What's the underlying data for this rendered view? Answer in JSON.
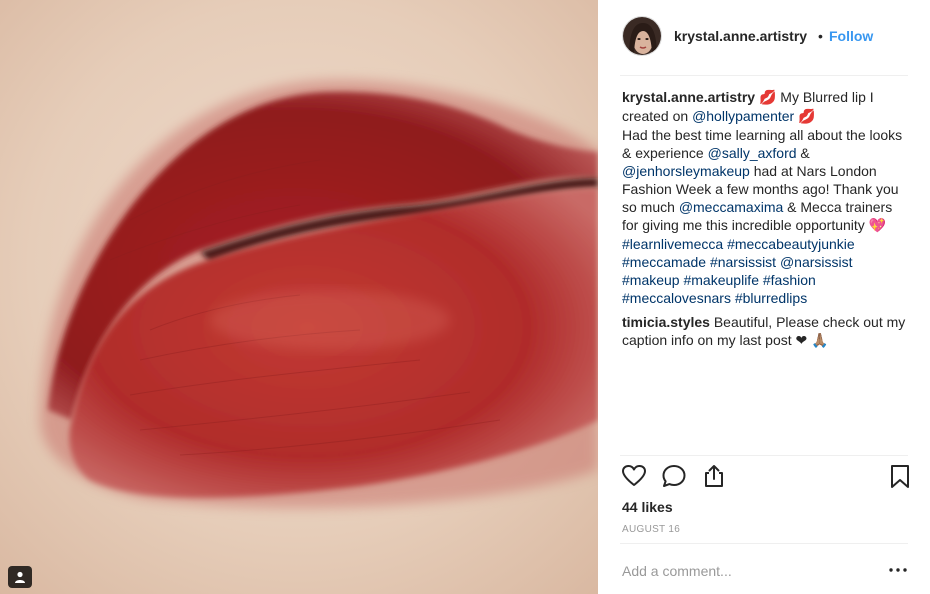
{
  "post": {
    "author": "krystal.anne.artistry",
    "follow_label": "Follow",
    "separator": "•",
    "likes": "44 likes",
    "date": "AUGUST 16",
    "comment_placeholder": "Add a comment..."
  },
  "caption": {
    "username": "krystal.anne.artistry",
    "kiss1": "💋",
    "t1": " My Blurred lip I created on ",
    "mention_holly": "@hollypamenter",
    "kiss2": "💋",
    "t2": "Had the best time learning all about the looks & experience ",
    "mention_sally": "@sally_axford",
    "t3": " & ",
    "mention_jen": "@jenhorsleymakeup",
    "t4": " had at Nars London Fashion Week a few months ago! Thank you so much ",
    "mention_mecca": "@meccamaxima",
    "t5": " & Mecca trainers for giving me this incredible opportunity ",
    "heart_emoji": "💖",
    "hashtags": [
      "#learnlivemecca",
      "#meccabeautyjunkie",
      "#meccamade",
      "#narsissist",
      "@narsissist",
      "#makeup",
      "#makeuplife",
      "#fashion",
      "#meccalovesnars",
      "#blurredlips"
    ]
  },
  "reply": {
    "username": "timicia.styles",
    "text": " Beautiful, Please check out my caption info on my last post ",
    "heart": "❤",
    "pray": "🙏🏽"
  },
  "icons": {
    "like": "heart-outline-icon",
    "comment": "speech-bubble-icon",
    "share": "share-icon",
    "save": "bookmark-icon",
    "more": "ellipsis-icon",
    "tagged": "person-tag-icon"
  },
  "colors": {
    "link": "#003569",
    "follow": "#3897f0",
    "text": "#262626",
    "muted": "#999999",
    "lip": "#b5282b"
  }
}
